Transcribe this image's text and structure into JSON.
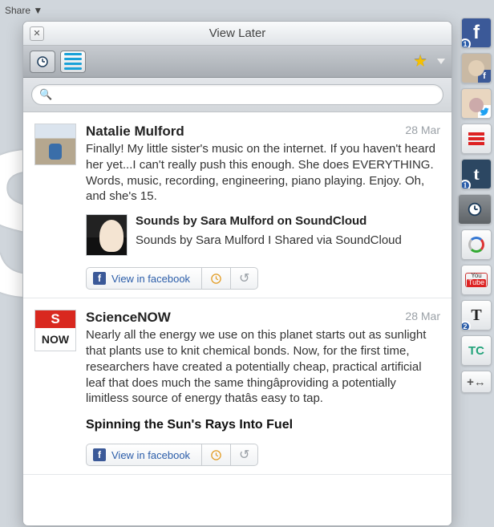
{
  "share_hint": "Share ▼",
  "panel": {
    "title": "View Later"
  },
  "search": {
    "placeholder": ""
  },
  "posts": [
    {
      "author": "Natalie Mulford",
      "date": "28 Mar",
      "text": "Finally! My little sister's music on the internet. If you haven't heard her yet...I can't really push this enough. She does EVERYTHING. Words, music, recording, engineering, piano playing. Enjoy. Oh, and she's 15.",
      "attachment": {
        "title": "Sounds by Sara Mulford on SoundCloud",
        "desc": "Sounds by Sara Mulford I Shared via SoundCloud"
      },
      "action_label": "View in facebook"
    },
    {
      "author": "ScienceNOW",
      "date": "28 Mar",
      "text": "Nearly all the energy we use on this planet starts out as sunlight that plants use to knit chemical bonds. Now, for the first time, researchers have created a potentially cheap, practical artificial leaf that does much the same thingâproviding a potentially limitless source of energy thatâs easy to tap.",
      "headline": "Spinning the Sun's Rays Into Fuel",
      "action_label": "View in facebook",
      "avatar_top": "S",
      "avatar_bot": "NOW"
    }
  ],
  "dock": {
    "badges": {
      "fb": "1",
      "tumblr": "1",
      "nyt": "2"
    },
    "tc": "TC",
    "plus": "+↔"
  }
}
